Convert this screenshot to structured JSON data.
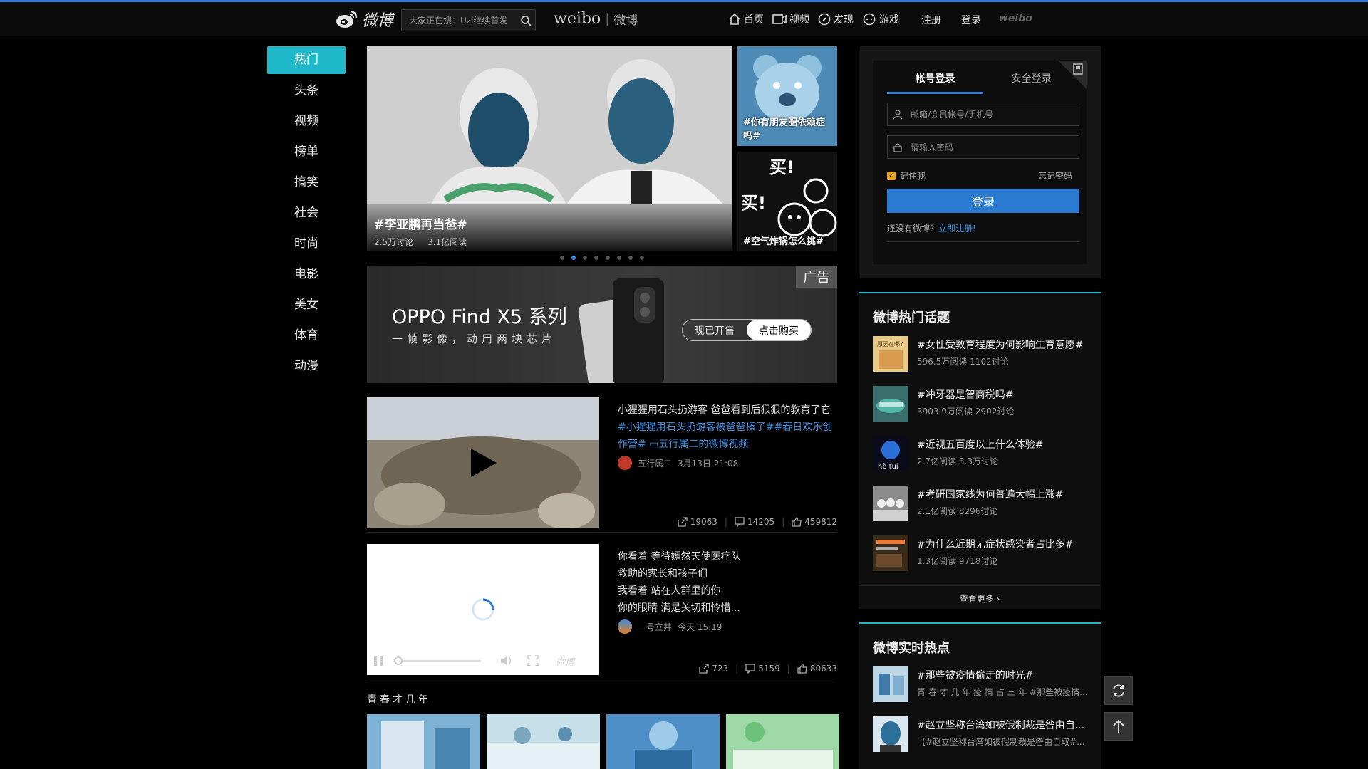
{
  "header": {
    "logo_text": "微博",
    "search_placeholder": "大家正在搜：Uzi继续首发",
    "brand_en": "weibo",
    "brand_cn": "微博",
    "nav": [
      {
        "label": "首页",
        "icon": "home-icon"
      },
      {
        "label": "视频",
        "icon": "video-icon"
      },
      {
        "label": "发现",
        "icon": "compass-icon"
      },
      {
        "label": "游戏",
        "icon": "gamepad-icon"
      }
    ],
    "register": "注册",
    "login": "登录",
    "weibo_small": "weibo"
  },
  "sidebar": {
    "items": [
      {
        "label": "热门",
        "active": true
      },
      {
        "label": "头条"
      },
      {
        "label": "视频"
      },
      {
        "label": "榜单"
      },
      {
        "label": "搞笑"
      },
      {
        "label": "社会"
      },
      {
        "label": "时尚"
      },
      {
        "label": "电影"
      },
      {
        "label": "美女"
      },
      {
        "label": "体育"
      },
      {
        "label": "动漫"
      }
    ]
  },
  "carousel": {
    "main": {
      "title": "#李亚鹏再当爸#",
      "discussions": "2.5万讨论",
      "reads": "3.1亿阅读"
    },
    "side": [
      {
        "title": "#你有朋友圈依赖症吗#"
      },
      {
        "title": "#空气炸锅怎么挑#"
      }
    ],
    "active_dot": 2
  },
  "ad": {
    "title": "OPPO Find X5 系列",
    "subtitle": "一帧影像，动用两块芯片",
    "tag": "广告",
    "cta_left": "现已开售",
    "cta_right": "点击购买"
  },
  "feeds": [
    {
      "text": "小猩猩用石头扔游客 爸爸看到后狠狠的教育了它",
      "tags": "#小猩猩用石头扔游客被爸爸揍了##春日欢乐创作营# ▭五行属二的微博视频",
      "author": "五行属二",
      "time": "3月13日 21:08",
      "reposts": "19063",
      "comments": "14205",
      "likes": "459812"
    },
    {
      "line1": "你看着 等待嫣然天使医疗队",
      "line2": "救助的家长和孩子们",
      "line3": "我看着 站在人群里的你",
      "line4": "你的眼睛 满是关切和怜惜...",
      "author": "一号立井",
      "time": "今天 15:19",
      "reposts": "723",
      "comments": "5159",
      "likes": "80633",
      "player_watermark": "微博"
    }
  ],
  "section": {
    "title": "青春才几年"
  },
  "login": {
    "tab_account": "帐号登录",
    "tab_secure": "安全登录",
    "username_placeholder": "邮箱/会员帐号/手机号",
    "password_placeholder": "请输入密码",
    "remember": "记住我",
    "forgot": "忘记密码",
    "button": "登录",
    "no_account": "还没有微博？",
    "register_link": "立即注册!"
  },
  "hot_topics": {
    "title": "微博热门话题",
    "items": [
      {
        "name": "#女性受教育程度为何影响生育意愿#",
        "stats": "596.5万阅读 1102讨论",
        "thumb_text": "原因在哪？"
      },
      {
        "name": "#冲牙器是智商税吗#",
        "stats": "3903.9万阅读 2902讨论"
      },
      {
        "name": "#近视五百度以上什么体验#",
        "stats": "2.7亿阅读 3.3万讨论",
        "thumb_text": "hè tui"
      },
      {
        "name": "#考研国家线为何普遍大幅上涨#",
        "stats": "2.1亿阅读 8296讨论"
      },
      {
        "name": "#为什么近期无症状感染者占比多#",
        "stats": "1.3亿阅读 9718讨论"
      }
    ],
    "more": "查看更多 ›"
  },
  "realtime": {
    "title": "微博实时热点",
    "items": [
      {
        "name": "#那些被疫情偷走的时光#",
        "desc": "青 春 才 几 年 疫 情 占 三 年 #那些被疫情..."
      },
      {
        "name": "#赵立坚称台湾如被俄制裁是咎由自...",
        "desc": "【#赵立坚称台湾如被俄制裁是咎由自取#..."
      }
    ]
  },
  "colors": {
    "accent": "#2a7bd1",
    "cyan": "#1fb9c9",
    "link": "#3b8de0"
  }
}
